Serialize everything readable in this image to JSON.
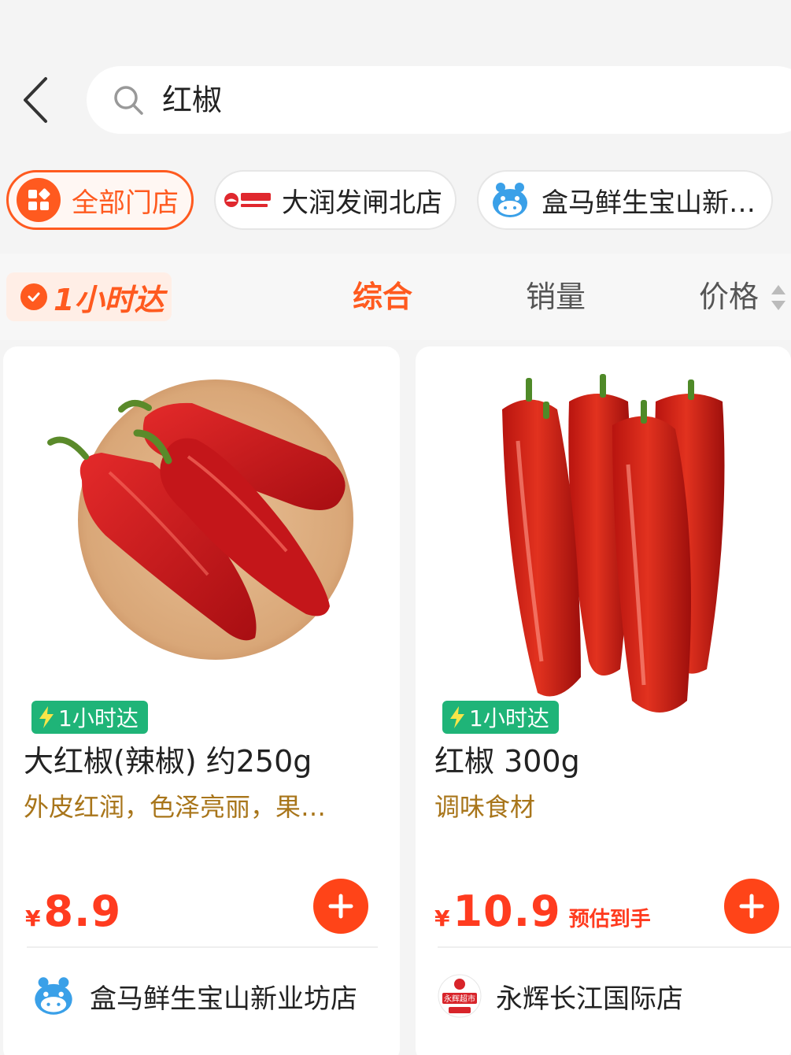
{
  "search": {
    "query": "红椒"
  },
  "store_chips": [
    {
      "label": "全部门店",
      "active": true,
      "icon": "grid-icon"
    },
    {
      "label": "大润发闸北店",
      "active": false,
      "icon": "darunfa-logo"
    },
    {
      "label": "盒马鲜生宝山新…",
      "active": false,
      "icon": "hema-logo"
    }
  ],
  "filter": {
    "one_hour_label": "1小时达",
    "sort_tabs": [
      "综合",
      "销量",
      "价格"
    ],
    "active_sort": "综合"
  },
  "products": [
    {
      "tag": "1小时达",
      "title": "大红椒(辣椒) 约250g",
      "desc": "外皮红润，色泽亮丽，果…",
      "currency": "¥",
      "price": "8.9",
      "price_note": "",
      "store": "盒马鲜生宝山新业坊店",
      "store_logo": "hema-logo"
    },
    {
      "tag": "1小时达",
      "title": "红椒 300g",
      "desc": "调味食材",
      "currency": "¥",
      "price": "10.9",
      "price_note": "预估到手",
      "store": "永辉长江国际店",
      "store_logo": "yonghui-logo",
      "store_logo_text": "永辉超市"
    }
  ],
  "colors": {
    "accent": "#ff5a1f",
    "price": "#ff3b1f",
    "tag_green": "#1fb478",
    "desc_gold": "#a8751a"
  }
}
